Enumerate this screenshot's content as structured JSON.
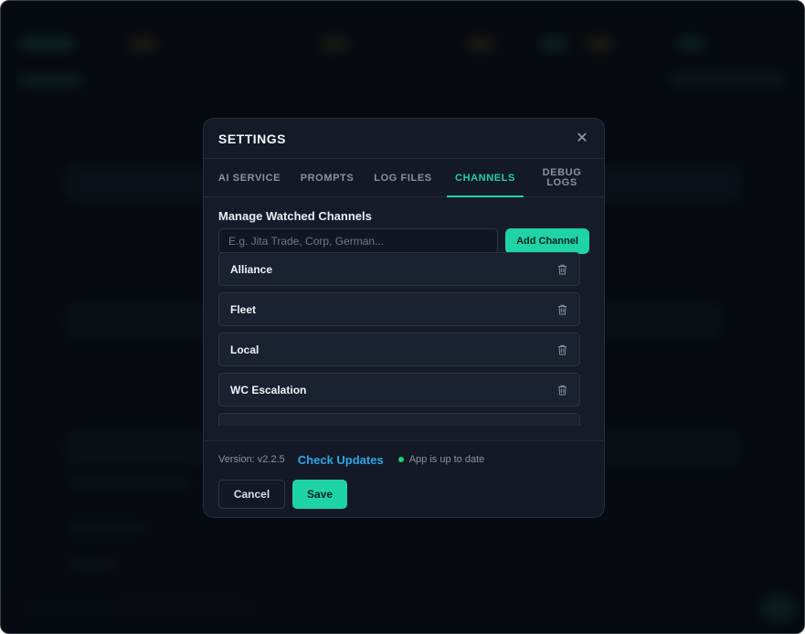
{
  "modal": {
    "title": "SETTINGS",
    "close_icon": "close-icon"
  },
  "tabs": [
    {
      "label": "AI SERVICE",
      "active": false
    },
    {
      "label": "PROMPTS",
      "active": false
    },
    {
      "label": "LOG FILES",
      "active": false
    },
    {
      "label": "CHANNELS",
      "active": true
    },
    {
      "label": "DEBUG LOGS",
      "active": false
    }
  ],
  "channels": {
    "section_title": "Manage Watched Channels",
    "input_placeholder": "E.g. Jita Trade, Corp, German...",
    "input_value": "",
    "add_button": "Add Channel",
    "items": [
      {
        "name": "Alliance",
        "icon": "trash-icon"
      },
      {
        "name": "Fleet",
        "icon": "trash-icon"
      },
      {
        "name": "Local",
        "icon": "trash-icon"
      },
      {
        "name": "WC Escalation",
        "icon": "trash-icon"
      }
    ]
  },
  "footer": {
    "version": "Version: v2.2.5",
    "check_updates": "Check Updates",
    "status": "App is up to date",
    "cancel": "Cancel",
    "save": "Save"
  },
  "colors": {
    "accent": "#1ed3a6",
    "link": "#2ea7e8",
    "status_ok": "#1ed36f",
    "modal_bg": "#141a26"
  }
}
